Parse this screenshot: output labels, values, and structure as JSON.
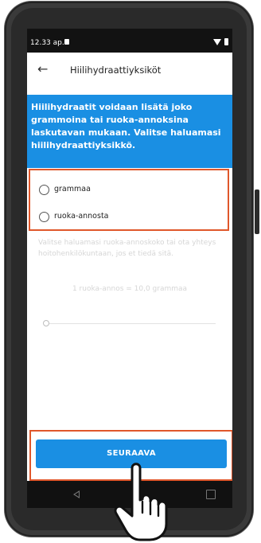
{
  "status_bar": {
    "time": "12.33 ap."
  },
  "app_bar": {
    "back_icon": "arrow-left-icon",
    "title": "Hiilihydraattiyksiköt"
  },
  "intro": {
    "text": "Hiilihydraatit voidaan lisätä joko grammoina tai ruoka-annoksina laskutavan mukaan. Valitse haluamasi hiilihydraattiyksikkö."
  },
  "options": [
    {
      "label": "grammaa",
      "selected": false
    },
    {
      "label": "ruoka-annosta",
      "selected": false
    }
  ],
  "hint": "Valitse haluamasi ruoka-annoskoko tai ota yhteys hoitohenkilökuntaan, jos et tiedä sitä.",
  "ratio": "1 ruoka-annos = 10,0 grammaa",
  "next_button": "SEURAAVA",
  "colors": {
    "accent": "#1a8fe3",
    "highlight": "#e0572b"
  }
}
